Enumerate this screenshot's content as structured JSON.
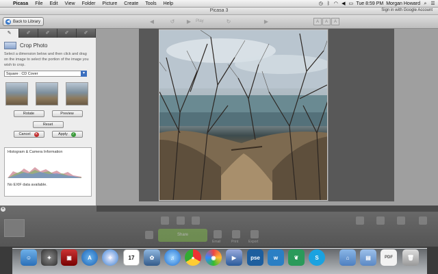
{
  "menubar": {
    "app_name": "Picasa",
    "items": [
      "File",
      "Edit",
      "View",
      "Folder",
      "Picture",
      "Create",
      "Tools",
      "Help"
    ],
    "clock": "Tue 8:59 PM",
    "user": "Morgan Howard"
  },
  "window": {
    "title": "Picasa 3",
    "account_link": "Sign in with Google Account"
  },
  "toolbar": {
    "back_label": "Back to Library",
    "play_label": "Play",
    "size_buttons": [
      "A",
      "A",
      "A"
    ]
  },
  "panel": {
    "tabs": [
      "wrench",
      "brush",
      "brush2",
      "brush3",
      "brush4"
    ],
    "crop_title": "Crop Photo",
    "instructions": "Select a dimension below and then click and drag on the image to select the portion of the image you wish to crop.",
    "dimension_select": "Square : CD Cover",
    "rotate_label": "Rotate",
    "preview_label": "Preview",
    "reset_label": "Reset",
    "cancel_label": "Cancel",
    "apply_label": "Apply",
    "histogram_title": "Histogram & Camera Information",
    "exif_note": "No EXIF data available."
  },
  "bottom": {
    "share_label": "Share",
    "email_label": "Email",
    "print_label": "Print",
    "export_label": "Export"
  },
  "dock": {
    "items": [
      "finder",
      "launchpad",
      "photo-booth",
      "app-store",
      "safari",
      "calendar",
      "iphoto",
      "itunes",
      "chrome",
      "picasa",
      "facetime",
      "pse",
      "wunderlist",
      "vine",
      "skype",
      "folder",
      "documents",
      "pdf",
      "trash"
    ],
    "calendar_day": "17",
    "pse_label": "pse"
  },
  "colors": {
    "accent_blue": "#3b6fbf",
    "apply_green": "#3a9a3a",
    "cancel_red": "#c23030",
    "share_green": "#7cae4e"
  }
}
